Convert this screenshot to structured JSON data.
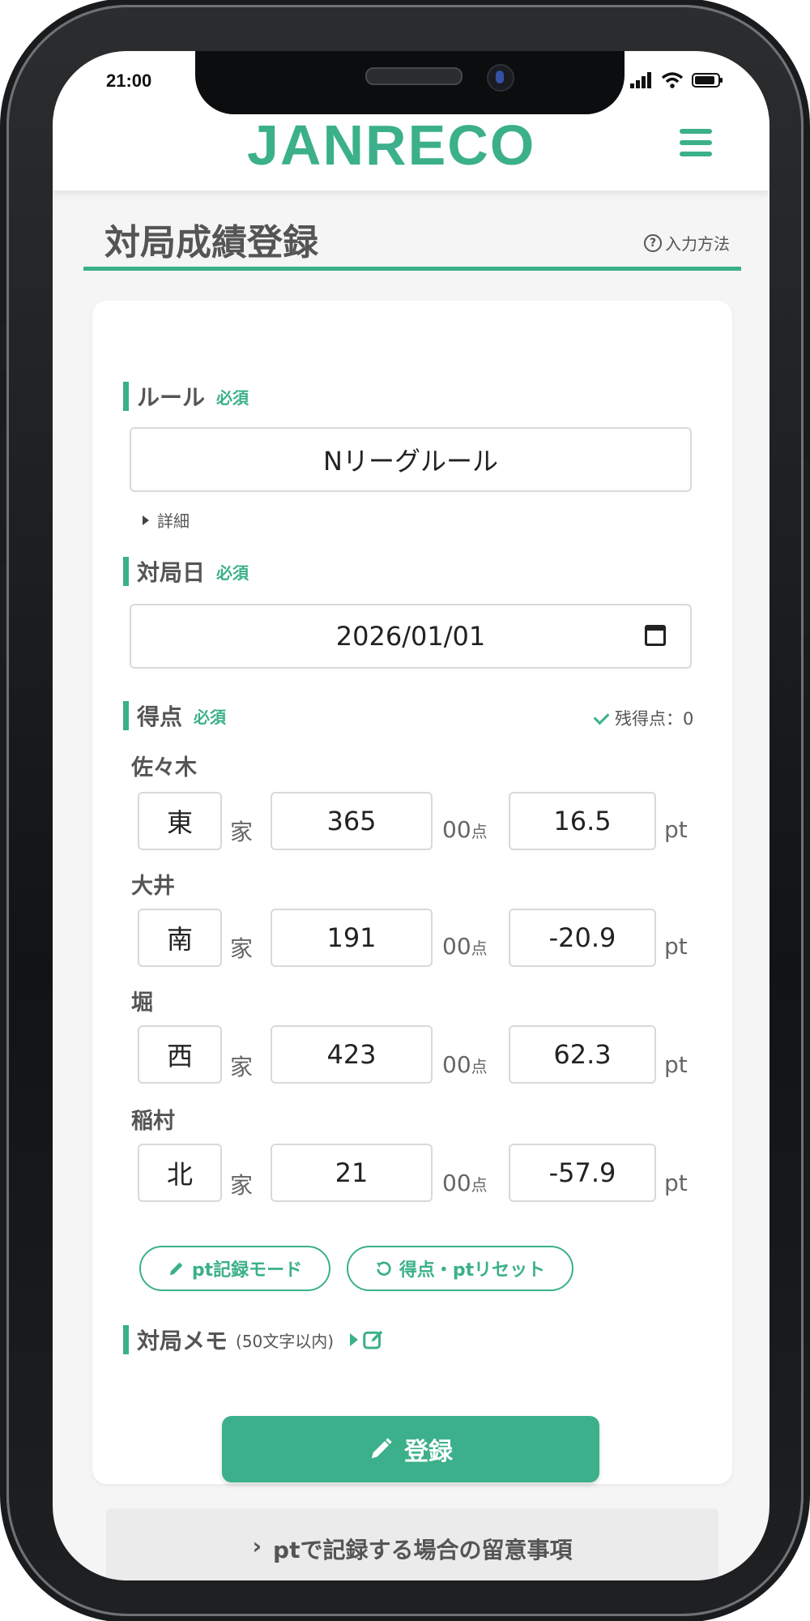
{
  "status_bar": {
    "time": "21:00",
    "icons": [
      "signal-icon",
      "wifi-icon",
      "battery-icon"
    ]
  },
  "header": {
    "logo": "JANRECO",
    "menu_icon": "hamburger-menu-icon"
  },
  "page": {
    "title": "対局成績登録",
    "howto_label": "入力方法",
    "howto_icon": "?"
  },
  "form": {
    "required_label": "必須",
    "rule": {
      "label": "ルール",
      "value": "Nリーグルール",
      "details_label": "詳細"
    },
    "date": {
      "label": "対局日",
      "value": "2026/01/01"
    },
    "score": {
      "label": "得点",
      "remaining": "残得点：0",
      "seat_suffix": "家",
      "score_suffix_main": "00",
      "score_suffix_unit": "点",
      "pt_suffix": "pt",
      "players": [
        {
          "name": "佐々木",
          "seat": "東",
          "score": "365",
          "pt": "16.5"
        },
        {
          "name": "大井",
          "seat": "南",
          "score": "191",
          "pt": "-20.9"
        },
        {
          "name": "堀",
          "seat": "西",
          "score": "423",
          "pt": "62.3"
        },
        {
          "name": "稲村",
          "seat": "北",
          "score": "21",
          "pt": "-57.9"
        }
      ]
    },
    "pt_mode_button": "pt記録モード",
    "reset_button": "得点・ptリセット",
    "memo": {
      "label": "対局メモ",
      "hint": "(50文字以内)"
    },
    "submit_button": "登録"
  },
  "notice": {
    "label": "ptで記録する場合の留意事項"
  },
  "colors": {
    "accent": "#3bb08a",
    "text": "#555555",
    "background": "#f5f5f5"
  }
}
